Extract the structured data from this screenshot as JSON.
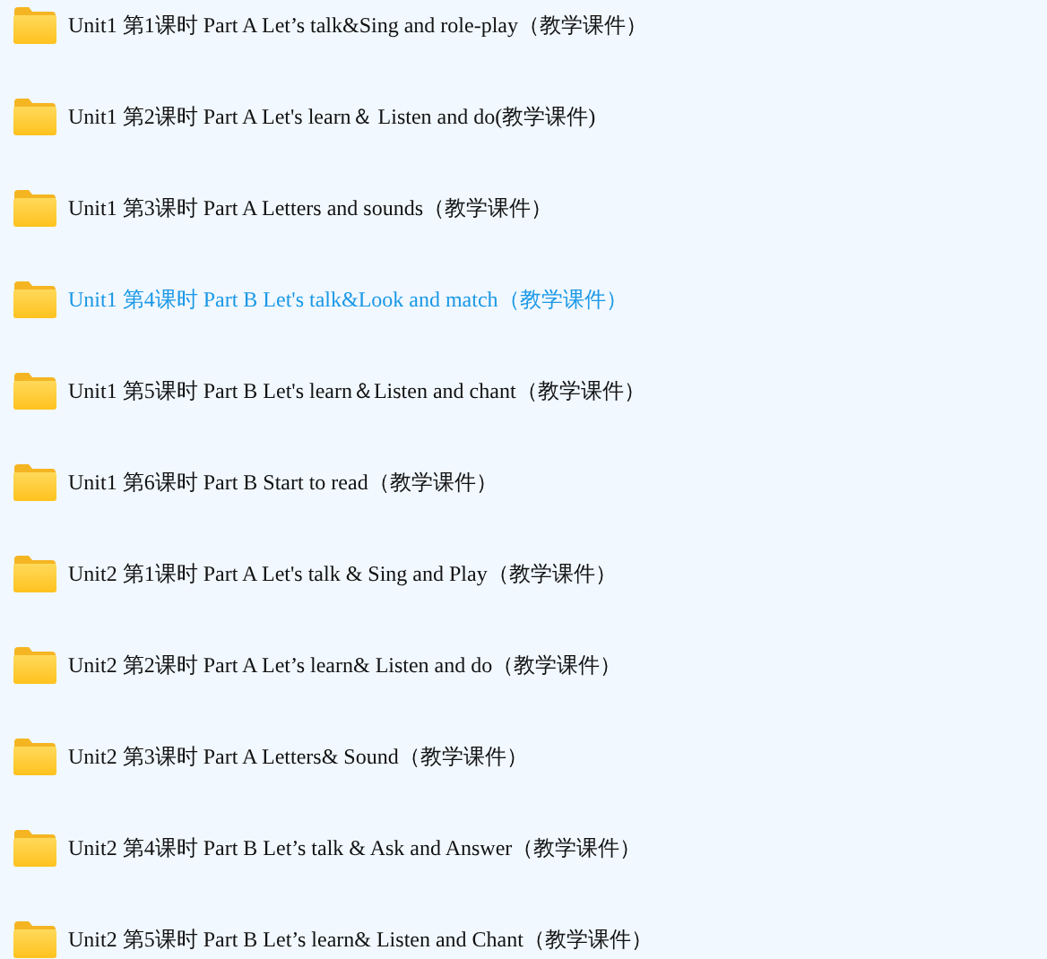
{
  "folders": [
    {
      "name": "Unit1 第1课时 Part A Let’s talk&Sing and role-play（教学课件）",
      "selected": false
    },
    {
      "name": "Unit1 第2课时 Part A Let's learn＆ Listen and do(教学课件)",
      "selected": false
    },
    {
      "name": "Unit1 第3课时 Part A Letters and sounds（教学课件）",
      "selected": false
    },
    {
      "name": "Unit1 第4课时 Part B Let's talk&Look and match（教学课件）",
      "selected": true
    },
    {
      "name": "Unit1 第5课时 Part B Let's learn＆Listen and chant（教学课件）",
      "selected": false
    },
    {
      "name": "Unit1 第6课时 Part B Start to read（教学课件）",
      "selected": false
    },
    {
      "name": "Unit2 第1课时 Part A Let's talk & Sing and Play（教学课件）",
      "selected": false
    },
    {
      "name": "Unit2 第2课时 Part A Let’s learn& Listen and do（教学课件）",
      "selected": false
    },
    {
      "name": "Unit2 第3课时 Part A Letters& Sound（教学课件）",
      "selected": false
    },
    {
      "name": "Unit2 第4课时 Part B Let’s talk & Ask and Answer（教学课件）",
      "selected": false
    },
    {
      "name": "Unit2 第5课时 Part B Let’s learn& Listen and Chant（教学课件）",
      "selected": false
    }
  ]
}
